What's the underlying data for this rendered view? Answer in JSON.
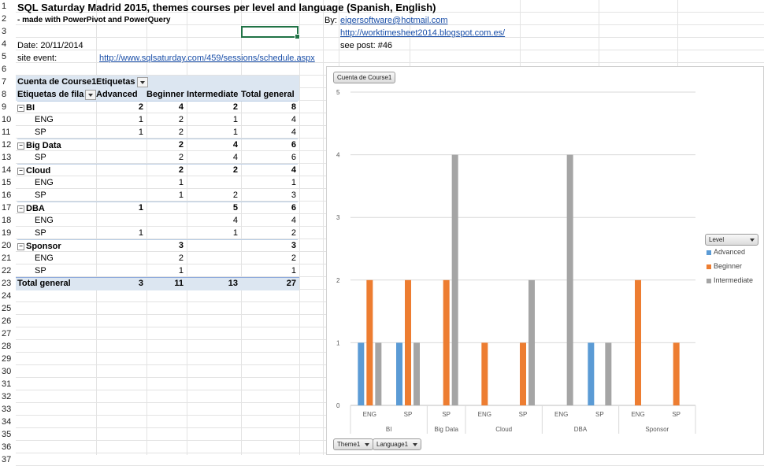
{
  "sheet": {
    "title": "SQL Saturday Madrid 2015, themes courses per level and language (Spanish, English)",
    "subtitle": " - made with PowerPivot and PowerQuery",
    "by_label": "By:",
    "email": "eigersoftware@hotmail.com",
    "blog_url": "http://worktimesheet2014.blogspot.com.es/",
    "post": "see post: #46",
    "date": "Date: 20/11/2014",
    "site_label": "site event:",
    "site_url": "http://www.sqlsaturday.com/459/sessions/schedule.aspx"
  },
  "row_numbers": [
    "1",
    "2",
    "3",
    "4",
    "5",
    "6",
    "7",
    "8",
    "9",
    "10",
    "11",
    "12",
    "13",
    "14",
    "15",
    "16",
    "17",
    "18",
    "19",
    "20",
    "21",
    "22",
    "23",
    "24",
    "25",
    "26",
    "27",
    "28",
    "29",
    "30",
    "31",
    "32",
    "33",
    "34",
    "35",
    "36",
    "37"
  ],
  "pivot": {
    "value_label": "Cuenta de Course1",
    "col_labels_label": "Etiquetas",
    "row_labels_label": "Etiquetas de fila",
    "columns": [
      "Advanced",
      "Beginner",
      "Intermediate",
      "Total general"
    ],
    "rows": [
      {
        "label": "BI",
        "group": true,
        "values": [
          "2",
          "4",
          "2",
          "8"
        ]
      },
      {
        "label": "ENG",
        "group": false,
        "values": [
          "1",
          "2",
          "1",
          "4"
        ]
      },
      {
        "label": "SP",
        "group": false,
        "values": [
          "1",
          "2",
          "1",
          "4"
        ]
      },
      {
        "label": "Big Data",
        "group": true,
        "values": [
          "",
          "2",
          "4",
          "6"
        ]
      },
      {
        "label": "SP",
        "group": false,
        "values": [
          "",
          "2",
          "4",
          "6"
        ]
      },
      {
        "label": "Cloud",
        "group": true,
        "values": [
          "",
          "2",
          "2",
          "4"
        ]
      },
      {
        "label": "ENG",
        "group": false,
        "values": [
          "",
          "1",
          "",
          "1"
        ]
      },
      {
        "label": "SP",
        "group": false,
        "values": [
          "",
          "1",
          "2",
          "3"
        ]
      },
      {
        "label": "DBA",
        "group": true,
        "values": [
          "1",
          "",
          "5",
          "6"
        ]
      },
      {
        "label": "ENG",
        "group": false,
        "values": [
          "",
          "",
          "4",
          "4"
        ]
      },
      {
        "label": "SP",
        "group": false,
        "values": [
          "1",
          "",
          "1",
          "2"
        ]
      },
      {
        "label": "Sponsor",
        "group": true,
        "values": [
          "",
          "3",
          "",
          "3"
        ]
      },
      {
        "label": "ENG",
        "group": false,
        "values": [
          "",
          "2",
          "",
          "2"
        ]
      },
      {
        "label": "SP",
        "group": false,
        "values": [
          "",
          "1",
          "",
          "1"
        ]
      }
    ],
    "total": {
      "label": "Total general",
      "values": [
        "3",
        "11",
        "13",
        "27"
      ]
    }
  },
  "chart_data": {
    "type": "bar",
    "value_field_button": "Cuenta de Course1",
    "legend_field_button": "Level",
    "axis_field_buttons": [
      "Theme1",
      "Language1"
    ],
    "legend_position": "right",
    "ylim": [
      0,
      5
    ],
    "yticks": [
      "0",
      "1",
      "2",
      "3",
      "4",
      "5"
    ],
    "grid": true,
    "groups": [
      {
        "name": "BI",
        "categories": [
          "ENG",
          "SP"
        ]
      },
      {
        "name": "Big Data",
        "categories": [
          "SP"
        ]
      },
      {
        "name": "Cloud",
        "categories": [
          "ENG",
          "SP"
        ]
      },
      {
        "name": "DBA",
        "categories": [
          "ENG",
          "SP"
        ]
      },
      {
        "name": "Sponsor",
        "categories": [
          "ENG",
          "SP"
        ]
      }
    ],
    "series": [
      {
        "name": "Advanced",
        "color": "#5b9bd5",
        "values": [
          1,
          1,
          0,
          0,
          0,
          0,
          1,
          0,
          0
        ]
      },
      {
        "name": "Beginner",
        "color": "#ed7d31",
        "values": [
          2,
          2,
          2,
          1,
          1,
          0,
          0,
          2,
          1
        ]
      },
      {
        "name": "Intermediate",
        "color": "#a5a5a5",
        "values": [
          1,
          1,
          4,
          0,
          2,
          4,
          1,
          0,
          0
        ]
      }
    ]
  }
}
